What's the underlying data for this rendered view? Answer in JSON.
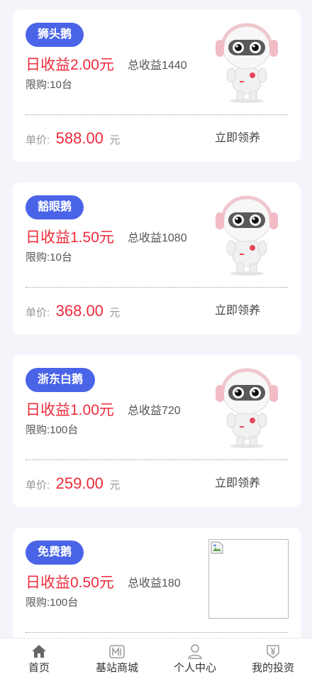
{
  "products": [
    {
      "name": "狮头鹅",
      "daily_income": "日收益2.00元",
      "total_income": "总收益1440",
      "limit": "限购:10台",
      "price_label": "单价:",
      "price": "588.00",
      "price_unit": "元",
      "action": "立即领养",
      "image": "robot-mascot"
    },
    {
      "name": "豁眼鹅",
      "daily_income": "日收益1.50元",
      "total_income": "总收益1080",
      "limit": "限购:10台",
      "price_label": "单价:",
      "price": "368.00",
      "price_unit": "元",
      "action": "立即领养",
      "image": "robot-mascot"
    },
    {
      "name": "浙东白鹅",
      "daily_income": "日收益1.00元",
      "total_income": "总收益720",
      "limit": "限购:100台",
      "price_label": "单价:",
      "price": "259.00",
      "price_unit": "元",
      "action": "立即领养",
      "image": "robot-mascot"
    },
    {
      "name": "免费鹅",
      "daily_income": "日收益0.50元",
      "total_income": "总收益180",
      "limit": "限购:100台",
      "price_label": "",
      "price": "",
      "price_unit": "",
      "action": "",
      "image": "broken-image-icon"
    }
  ],
  "tabbar": {
    "items": [
      {
        "label": "首页",
        "icon": "home-icon"
      },
      {
        "label": "基站商城",
        "icon": "mall-icon"
      },
      {
        "label": "个人中心",
        "icon": "user-icon"
      },
      {
        "label": "我的投资",
        "icon": "investment-icon"
      }
    ]
  },
  "colors": {
    "accent": "#4a64e8",
    "price_red": "#ee2b3c",
    "background": "#f4f5fb"
  }
}
